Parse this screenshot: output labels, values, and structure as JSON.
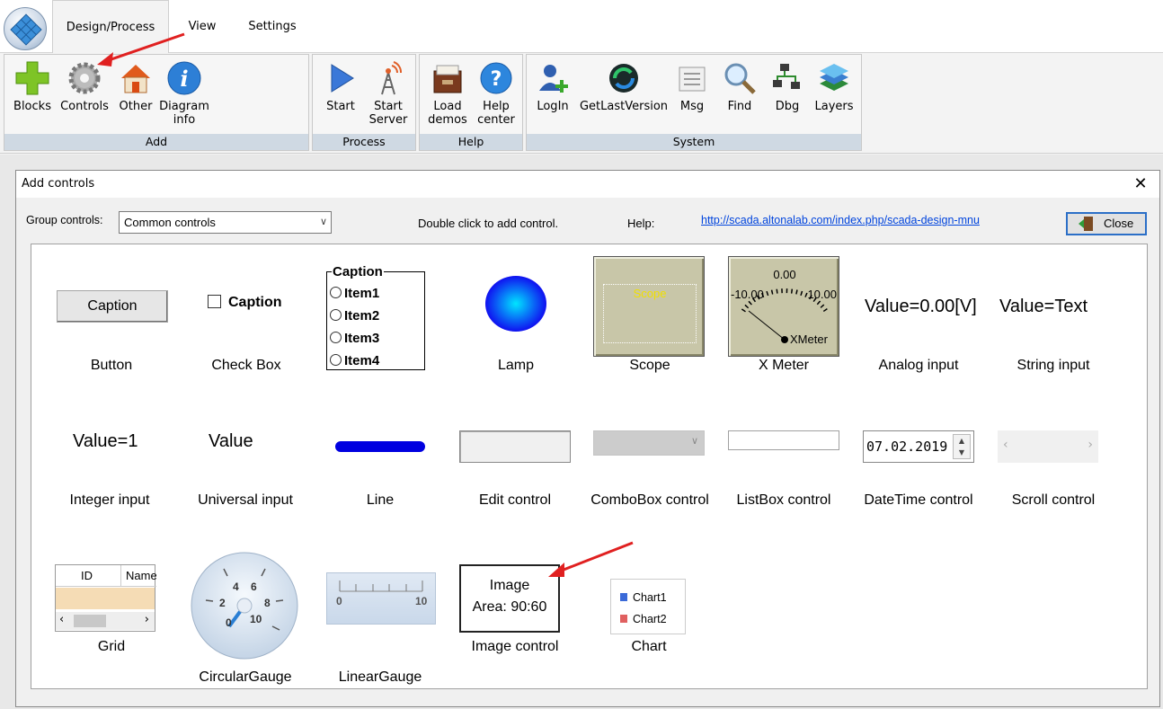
{
  "tabs": [
    "Design/Process",
    "View",
    "Settings"
  ],
  "ribbon": {
    "add": {
      "label": "Add",
      "buttons": [
        "Blocks",
        "Controls",
        "Other",
        "Diagram info"
      ]
    },
    "process": {
      "label": "Process",
      "buttons": [
        "Start",
        "Start Server"
      ]
    },
    "help": {
      "label": "Help",
      "buttons": [
        "Load demos",
        "Help center"
      ]
    },
    "system": {
      "label": "System",
      "buttons": [
        "LogIn",
        "GetLastVersion",
        "Msg",
        "Find",
        "Dbg",
        "Layers"
      ]
    }
  },
  "dialog": {
    "title": "Add controls",
    "group_label": "Group controls:",
    "group_value": "Common controls",
    "hint": "Double click to add control.",
    "help_label": "Help:",
    "help_link": "http://scada.altonalab.com/index.php/scada-design-mnu",
    "close_label": "Close"
  },
  "previews": {
    "button_caption": "Caption",
    "checkbox_caption": "Caption",
    "radio_caption": "Caption",
    "radio_items": [
      "Item1",
      "Item2",
      "Item3",
      "Item4"
    ],
    "scope_text": "Scope",
    "meter_top": "0.00",
    "meter_left": "-10.00",
    "meter_right": "10.00",
    "meter_name": "XMeter",
    "analog_value": "Value=0.00[V]",
    "string_value": "Value=Text",
    "integer_value": "Value=1",
    "universal_value": "Value",
    "datetime_value": "07.02.2019",
    "grid_col1": "ID",
    "grid_col2": "Name",
    "circ_ticks": [
      "2",
      "4",
      "6",
      "8",
      "10",
      "0"
    ],
    "linear_min": "0",
    "linear_max": "10",
    "image_line1": "Image",
    "image_line2": "Area: 90:60",
    "chart_series": [
      "Chart1",
      "Chart2"
    ]
  },
  "controls": [
    "Button",
    "Check Box",
    "Lamp",
    "Scope",
    "X Meter",
    "Analog input",
    "String input",
    "Integer input",
    "Universal input",
    "Line",
    "Edit control",
    "ComboBox control",
    "ListBox control",
    "DateTime control",
    "Scroll control",
    "Grid",
    "CircularGauge",
    "LinearGauge",
    "Image control",
    "Chart"
  ],
  "colors": {
    "lamp": "#1a66ff",
    "line": "#0000e0",
    "scope_bg": "#c8c6a8",
    "arrow": "#e02020",
    "group_header": "#cfd9e3"
  }
}
